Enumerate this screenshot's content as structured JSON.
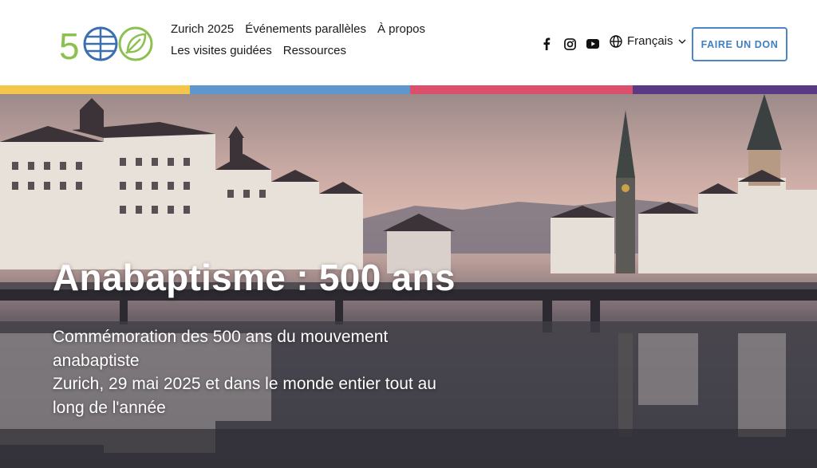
{
  "header": {
    "logo_text": "500",
    "nav": [
      "Zurich 2025",
      "Événements parallèles",
      "À propos",
      "Les visites guidées",
      "Ressources"
    ],
    "language": "Français",
    "donate_label": "FAIRE UN DON",
    "social_icons": [
      "facebook-icon",
      "instagram-icon",
      "youtube-icon"
    ]
  },
  "colors": {
    "accent_blue": "#4a86c8",
    "logo_green": "#8cc152",
    "logo_blue": "#3a6fb0",
    "stripe": [
      "#f4c64a",
      "#5e97d0",
      "#dc4f6a",
      "#5a3a84"
    ]
  },
  "hero": {
    "title": "Anabaptisme : 500 ans",
    "subtitle_lines": [
      "Commémoration des 500 ans du mouvement",
      "anabaptiste",
      "Zurich, 29 mai 2025 et dans le monde entier tout au",
      "long de l'année"
    ]
  }
}
